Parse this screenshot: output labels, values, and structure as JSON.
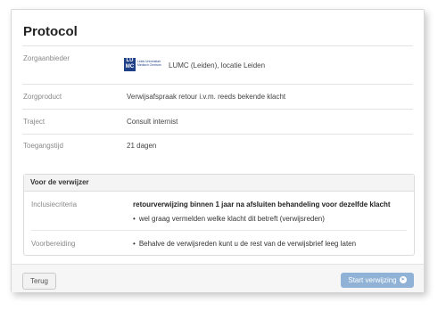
{
  "page": {
    "title": "Protocol"
  },
  "rows": {
    "zorgaanbieder": {
      "label": "Zorgaanbieder",
      "value": "LUMC (Leiden), locatie Leiden",
      "logo_mark": "LU MC",
      "logo_text_1": "Leids Universitair",
      "logo_text_2": "Medisch Centrum"
    },
    "zorgproduct": {
      "label": "Zorgproduct",
      "value": "Verwijsafspraak retour i.v.m. reeds bekende klacht"
    },
    "traject": {
      "label": "Traject",
      "value": "Consult internist"
    },
    "toegangstijd": {
      "label": "Toegangstijd",
      "value": "21 dagen"
    }
  },
  "panel": {
    "heading": "Voor de verwijzer",
    "inclusie_label": "Inclusiecriteria",
    "inclusie_main": "retourverwijzing binnen 1 jaar na afsluiten behandeling voor dezelfde klacht",
    "inclusie_bullet": "wel graag vermelden welke klacht dit betreft (verwijsreden)",
    "voorbereiding_label": "Voorbereiding",
    "voorbereiding_bullet": "Behalve de verwijsreden kunt u de rest van de verwijsbrief leeg laten"
  },
  "footer": {
    "back_label": "Terug",
    "start_label": "Start verwijzing",
    "start_icon": "arrow-right-circle-icon"
  },
  "colors": {
    "brand": "#1f3f86",
    "primary_button": "#8fb2d6"
  }
}
